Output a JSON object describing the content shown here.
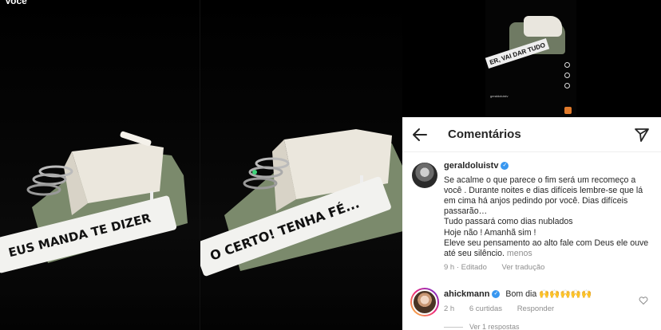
{
  "photo_left": {
    "top_label": "Você",
    "tape_text": "EUS MANDA TE DIZER"
  },
  "photo_middle": {
    "tape_text": "O CERTO! TENHA FÉ..."
  },
  "mini_video": {
    "tape_text": "ER, VAI DAR TUDO",
    "account": "geraldoluistv"
  },
  "header": {
    "title": "Comentários",
    "back_icon": "arrow-left-icon",
    "send_icon": "paper-plane-icon"
  },
  "comments": [
    {
      "username": "geraldoluistv",
      "verified": true,
      "text": "Se acalme o que parece o fim será um recomeço a você . Durante noites e dias difíceis lembre-se que lá em cima há anjos pedindo por você. Dias difíceis passarão…\nTudo passará como dias nublados\nHoje não ! Amanhã sim !\nEleve seu pensamento ao alto fale com Deus ele ouve até seu silêncio.",
      "more": "menos",
      "time": "9 h · Editado",
      "action": "Ver tradução"
    },
    {
      "username": "ahickmann",
      "verified": true,
      "text": "Bom dia 🙌🙌🙌🙌🙌",
      "time": "2 h",
      "likes": "6 curtidas",
      "action": "Responder",
      "replies": "Ver 1 respostas"
    }
  ],
  "colors": {
    "machine_body": "#7b8a6c",
    "machine_top": "#ebe7dd",
    "tape": "#f2f2ef",
    "verified": "#3897f0",
    "text": "#262626",
    "muted": "#8e8e8e"
  }
}
